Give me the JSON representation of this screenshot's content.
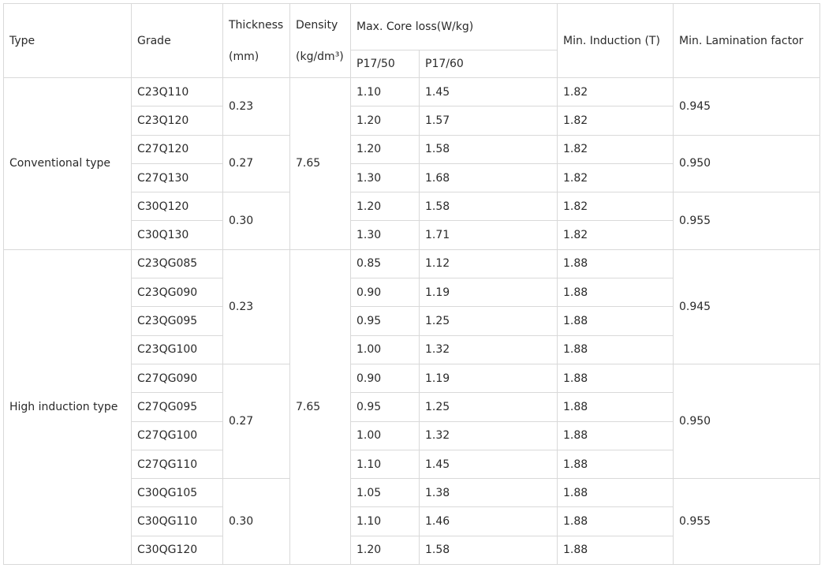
{
  "headers": {
    "type": "Type",
    "grade": "Grade",
    "thickness_l1": "Thickness",
    "thickness_l2": "(mm)",
    "density_l1": "Density",
    "density_l2": "(kg/dm³)",
    "core_loss": "Max. Core loss(W/kg)",
    "p1750": "P17/50",
    "p1760": "P17/60",
    "induction": "Min. Induction (T)",
    "lamination": "Min. Lamination factor"
  },
  "groups": [
    {
      "type": "Conventional type",
      "density": "7.65",
      "thickness": [
        "0.23",
        "0.27",
        "0.30"
      ],
      "lamination": [
        "0.945",
        "0.950",
        "0.955"
      ],
      "rows": [
        {
          "grade": "C23Q110",
          "p1750": "1.10",
          "p1760": "1.45",
          "induction": "1.82"
        },
        {
          "grade": "C23Q120",
          "p1750": "1.20",
          "p1760": "1.57",
          "induction": "1.82"
        },
        {
          "grade": "C27Q120",
          "p1750": "1.20",
          "p1760": "1.58",
          "induction": "1.82"
        },
        {
          "grade": "C27Q130",
          "p1750": "1.30",
          "p1760": "1.68",
          "induction": "1.82"
        },
        {
          "grade": "C30Q120",
          "p1750": "1.20",
          "p1760": "1.58",
          "induction": "1.82"
        },
        {
          "grade": "C30Q130",
          "p1750": "1.30",
          "p1760": "1.71",
          "induction": "1.82"
        }
      ]
    },
    {
      "type": "High induction type",
      "density": "7.65",
      "thickness": [
        "0.23",
        "0.27",
        "0.30"
      ],
      "lamination": [
        "0.945",
        "0.950",
        "0.955"
      ],
      "rows": [
        {
          "grade": "C23QG085",
          "p1750": "0.85",
          "p1760": "1.12",
          "induction": "1.88"
        },
        {
          "grade": "C23QG090",
          "p1750": "0.90",
          "p1760": "1.19",
          "induction": "1.88"
        },
        {
          "grade": "C23QG095",
          "p1750": "0.95",
          "p1760": "1.25",
          "induction": "1.88"
        },
        {
          "grade": "C23QG100",
          "p1750": "1.00",
          "p1760": "1.32",
          "induction": "1.88"
        },
        {
          "grade": "C27QG090",
          "p1750": "0.90",
          "p1760": "1.19",
          "induction": "1.88"
        },
        {
          "grade": "C27QG095",
          "p1750": "0.95",
          "p1760": "1.25",
          "induction": "1.88"
        },
        {
          "grade": "C27QG100",
          "p1750": "1.00",
          "p1760": "1.32",
          "induction": "1.88"
        },
        {
          "grade": "C27QG110",
          "p1750": "1.10",
          "p1760": "1.45",
          "induction": "1.88"
        },
        {
          "grade": "C30QG105",
          "p1750": "1.05",
          "p1760": "1.38",
          "induction": "1.88"
        },
        {
          "grade": "C30QG110",
          "p1750": "1.10",
          "p1760": "1.46",
          "induction": "1.88"
        },
        {
          "grade": "C30QG120",
          "p1750": "1.20",
          "p1760": "1.58",
          "induction": "1.88"
        }
      ]
    }
  ]
}
